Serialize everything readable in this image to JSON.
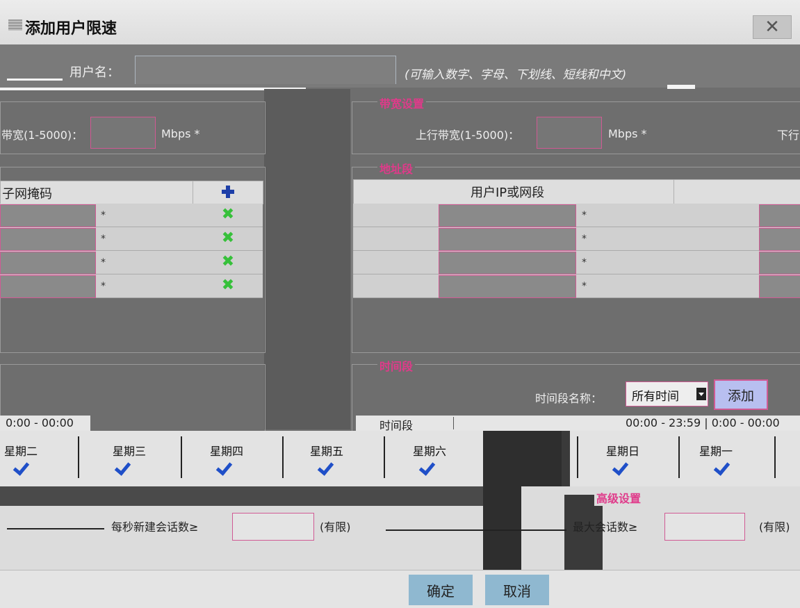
{
  "dialog": {
    "title": "添加用户限速",
    "close_icon": "close-icon"
  },
  "user": {
    "label": "用户名：",
    "value": "",
    "hint": "(可输入数字、字母、下划线、短线和中文)"
  },
  "bandwidth": {
    "legend": "带宽设置",
    "left_label": "带宽(1-5000)：",
    "left_unit": "Mbps *",
    "up_label": "上行带宽(1-5000)：",
    "up_unit": "Mbps *",
    "down_label_partial": "下行"
  },
  "address": {
    "legend": "地址段",
    "left_header": "子网掩码",
    "right_header": "用户IP或网段",
    "rows": [
      "*",
      "*",
      "*",
      "*"
    ]
  },
  "time": {
    "legend": "时间段",
    "name_label": "时间段名称：",
    "name_value": "所有时间",
    "add_label": "添加",
    "left_range": "0:00 - 00:00",
    "row_label": "时间段",
    "right_range": "00:00 - 23:59 | 0:00 - 00:00"
  },
  "weekdays_left": [
    "星期二",
    "星期三",
    "星期四",
    "星期五",
    "星期六"
  ],
  "weekdays_right": [
    "星期日",
    "星期一"
  ],
  "advanced": {
    "legend": "高级设置",
    "left_text": "每秒新建会话数≥",
    "right_text": "最大会话数≥",
    "tail_left": "(有限)",
    "tail_right": "(有限)"
  },
  "footer": {
    "ok": "确定",
    "cancel": "取消"
  }
}
